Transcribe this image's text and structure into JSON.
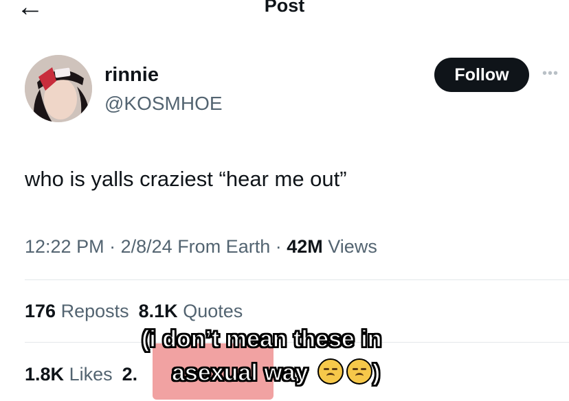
{
  "header": {
    "back_icon": "arrow-left-icon",
    "title": "Post"
  },
  "author": {
    "display_name": "rinnie",
    "handle": "@KOSMHOE",
    "follow_label": "Follow",
    "more_icon": "more-horizontal-icon"
  },
  "tweet": {
    "text": "who is yalls craziest “hear me out”"
  },
  "meta": {
    "time": "12:22 PM",
    "date": "2/8/24",
    "source": "From Earth",
    "views_count": "42M",
    "views_label": "Views"
  },
  "stats": {
    "reposts_count": "176",
    "reposts_label": "Reposts",
    "quotes_count": "8.1K",
    "quotes_label": "Quotes",
    "likes_count": "1.8K",
    "likes_label": "Likes",
    "bookmarks_count_partial": "2."
  },
  "overlay": {
    "caption_line_1": "(i don’t mean these in",
    "caption_line_2_pre": "a",
    "caption_line_2_redacted": "sexual",
    "caption_line_2_post": " way",
    "caption_line_2_end": ")",
    "emoji_icon": "disappointed-face-icon",
    "redact_color": "#f09a9a"
  }
}
